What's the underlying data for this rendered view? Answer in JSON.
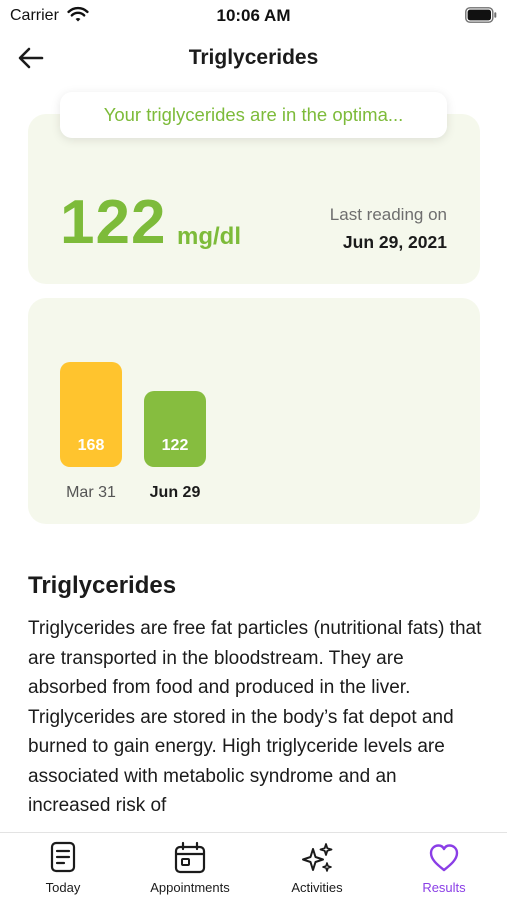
{
  "status_bar": {
    "carrier": "Carrier",
    "time": "10:06 AM"
  },
  "nav": {
    "title": "Triglycerides"
  },
  "banner": {
    "text": "Your triglycerides are in the optima..."
  },
  "reading": {
    "value": "122",
    "unit": "mg/dl",
    "label": "Last reading on",
    "date": "Jun 29, 2021"
  },
  "history": {
    "items": [
      {
        "label": "Mar 31",
        "value": "168",
        "color": "#ffc42e"
      },
      {
        "label": "Jun 29",
        "value": "122",
        "color": "#86bd3f"
      }
    ]
  },
  "info": {
    "title": "Triglycerides",
    "body": "Triglycerides are free fat particles (nutritional fats) that are transported in the bloodstream. They are absorbed from food and produced in the liver. Triglycerides are stored in the body’s fat depot and burned to gain energy. High triglyceride levels are associated with metabolic syndrome and an increased risk of"
  },
  "tabs": [
    {
      "label": "Today",
      "icon": "today-icon"
    },
    {
      "label": "Appointments",
      "icon": "calendar-icon"
    },
    {
      "label": "Activities",
      "icon": "sparkles-icon"
    },
    {
      "label": "Results",
      "icon": "heart-icon",
      "active": true
    }
  ],
  "colors": {
    "accent": "#7dbb3a",
    "active_tab": "#8a3ee6",
    "card_bg": "#f5f8ec",
    "bar_high": "#ffc42e",
    "bar_ok": "#86bd3f"
  }
}
